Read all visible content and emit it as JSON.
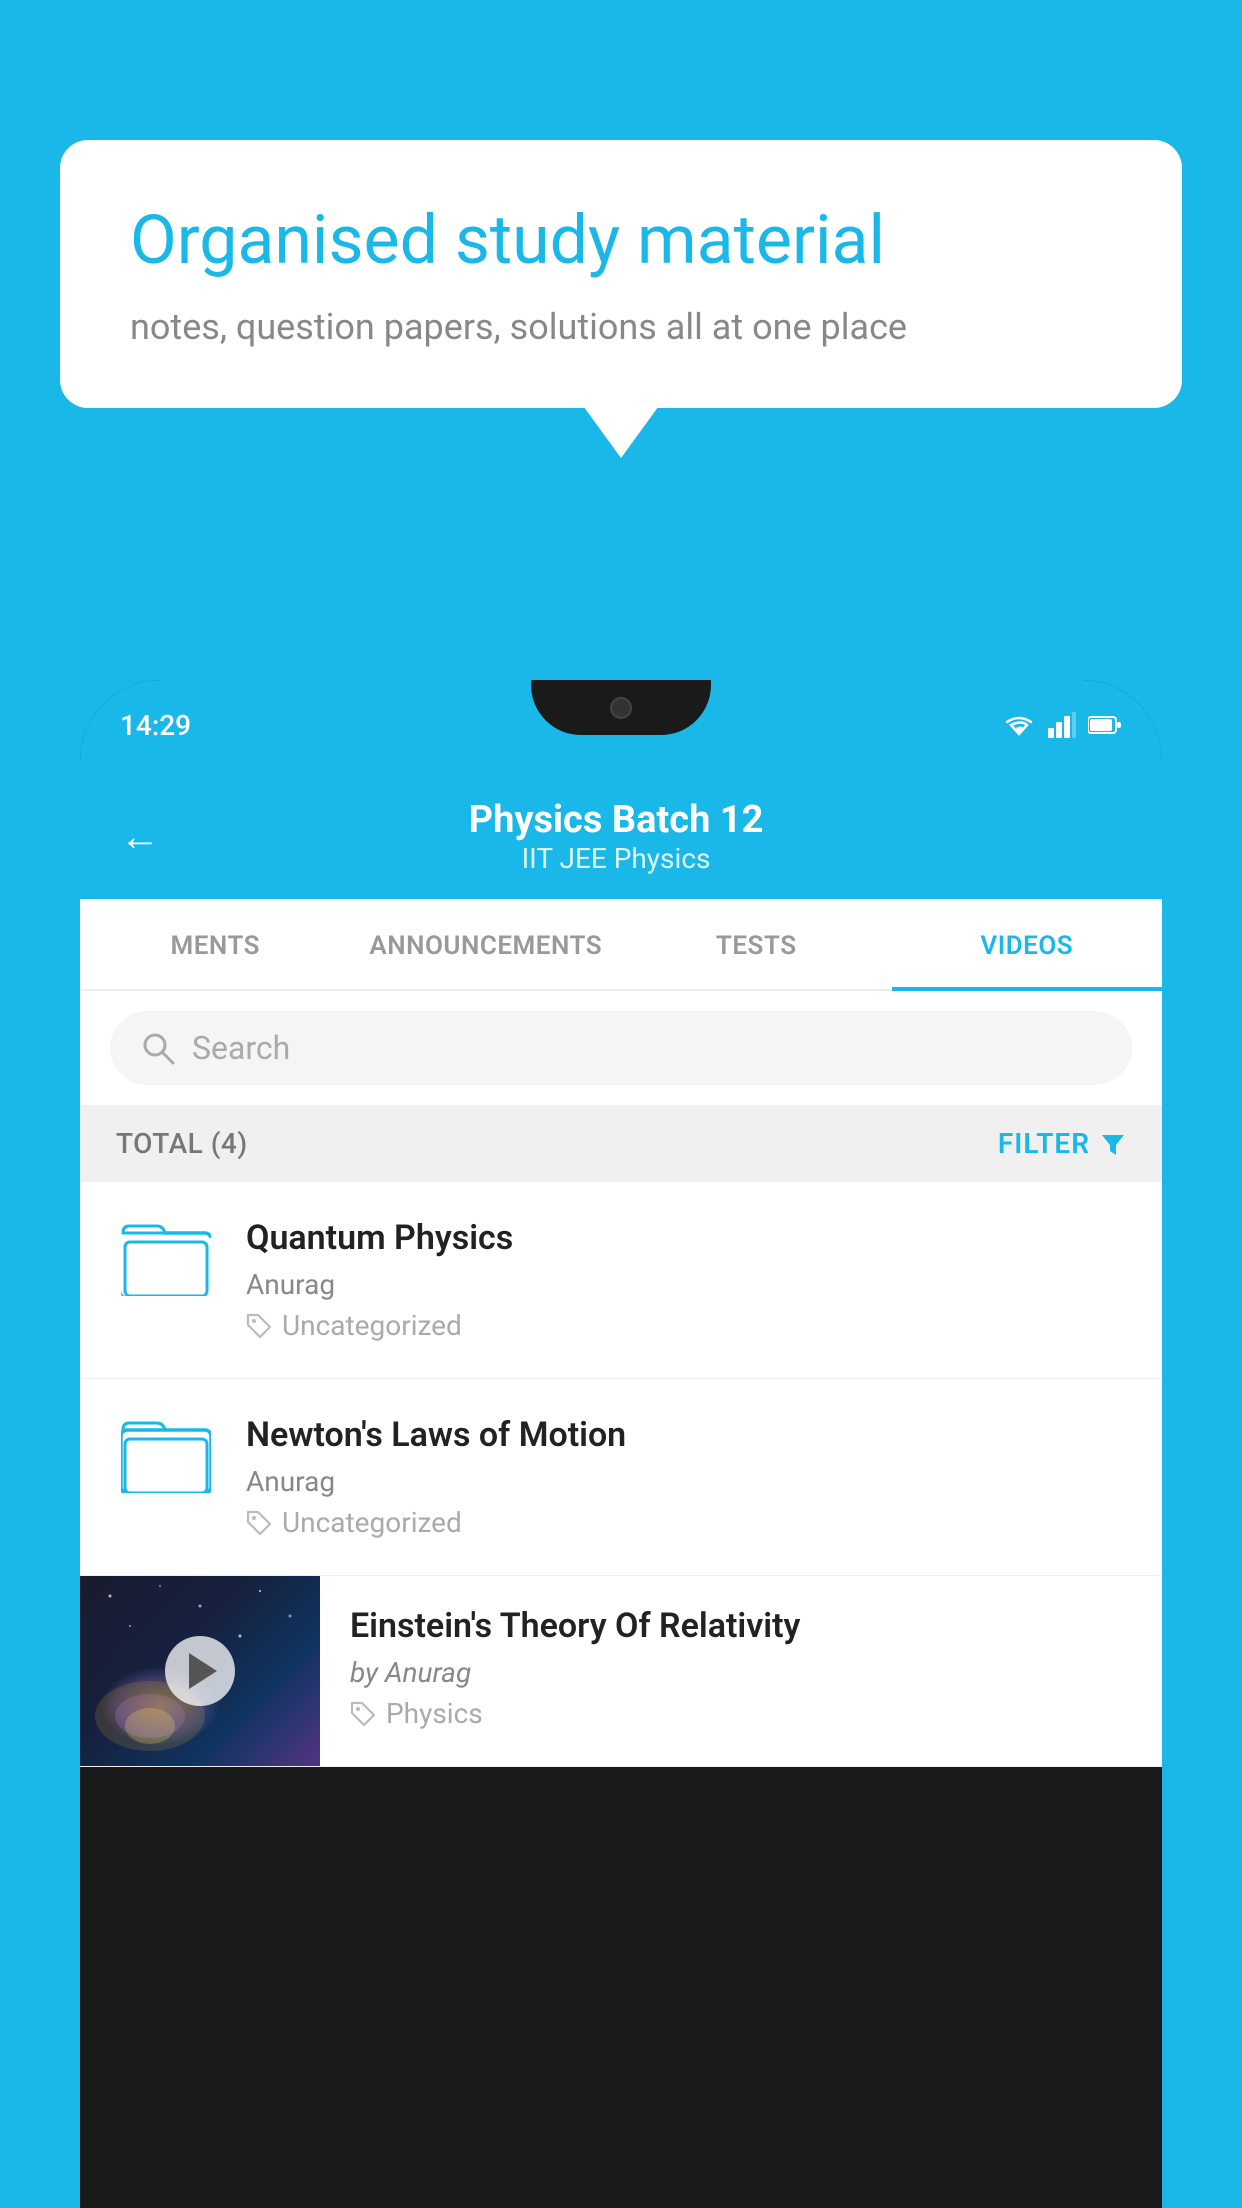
{
  "background_color": "#1ab8e8",
  "speech_bubble": {
    "title": "Organised study material",
    "subtitle": "notes, question papers, solutions all at one place"
  },
  "phone": {
    "status_bar": {
      "time": "14:29"
    },
    "app_header": {
      "back_label": "←",
      "title": "Physics Batch 12",
      "subtitle": "IIT JEE   Physics"
    },
    "tabs": [
      {
        "label": "MENTS",
        "active": false
      },
      {
        "label": "ANNOUNCEMENTS",
        "active": false
      },
      {
        "label": "TESTS",
        "active": false
      },
      {
        "label": "VIDEOS",
        "active": true
      }
    ],
    "search": {
      "placeholder": "Search"
    },
    "filter_bar": {
      "total_label": "TOTAL (4)",
      "filter_label": "FILTER"
    },
    "videos": [
      {
        "id": 1,
        "title": "Quantum Physics",
        "author": "Anurag",
        "tag": "Uncategorized",
        "has_thumbnail": false
      },
      {
        "id": 2,
        "title": "Newton's Laws of Motion",
        "author": "Anurag",
        "tag": "Uncategorized",
        "has_thumbnail": false
      },
      {
        "id": 3,
        "title": "Einstein's Theory Of Relativity",
        "author": "by Anurag",
        "tag": "Physics",
        "has_thumbnail": true
      }
    ]
  }
}
